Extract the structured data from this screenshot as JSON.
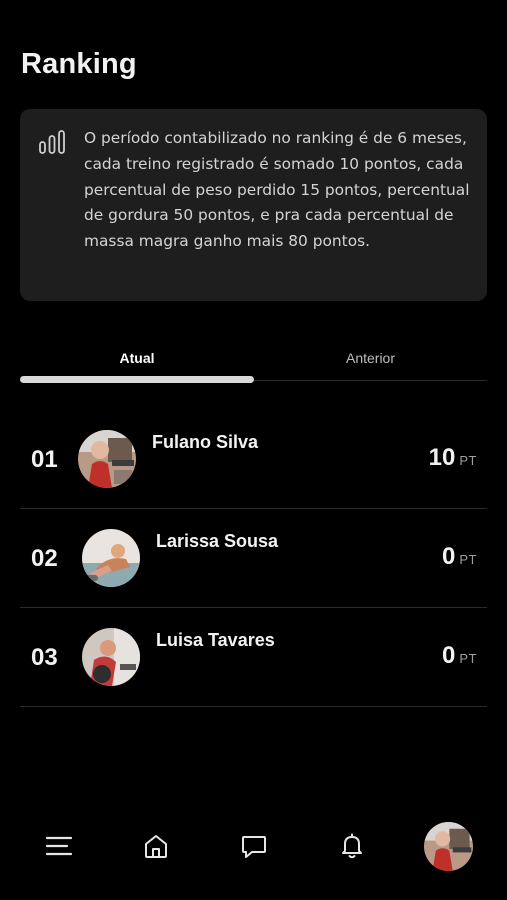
{
  "page": {
    "title": "Ranking"
  },
  "info": {
    "icon": "bar-chart-icon",
    "text": "O período contabilizado no ranking é de 6 meses, cada treino registrado é somado 10 pontos, cada percentual de peso perdido 15 pontos, percentual de gordura 50 pontos, e pra cada percentual de massa magra ganho mais 80 pontos."
  },
  "tabs": [
    {
      "label": "Atual",
      "active": true
    },
    {
      "label": "Anterior",
      "active": false
    }
  ],
  "ranking": [
    {
      "position": "01",
      "name": "Fulano Silva",
      "points": "10",
      "unit": "PT"
    },
    {
      "position": "02",
      "name": "Larissa Sousa",
      "points": "0",
      "unit": "PT"
    },
    {
      "position": "03",
      "name": "Luisa Tavares",
      "points": "0",
      "unit": "PT"
    }
  ],
  "nav": {
    "items": [
      "menu-icon",
      "home-icon",
      "chat-icon",
      "bell-icon",
      "profile-avatar"
    ]
  },
  "colors": {
    "background": "#000000",
    "card": "#1e1e1e",
    "text": "#f2f2f2",
    "muted": "#9e9e9e",
    "divider": "#2a2a2a",
    "indicator": "#d9d9d9"
  }
}
